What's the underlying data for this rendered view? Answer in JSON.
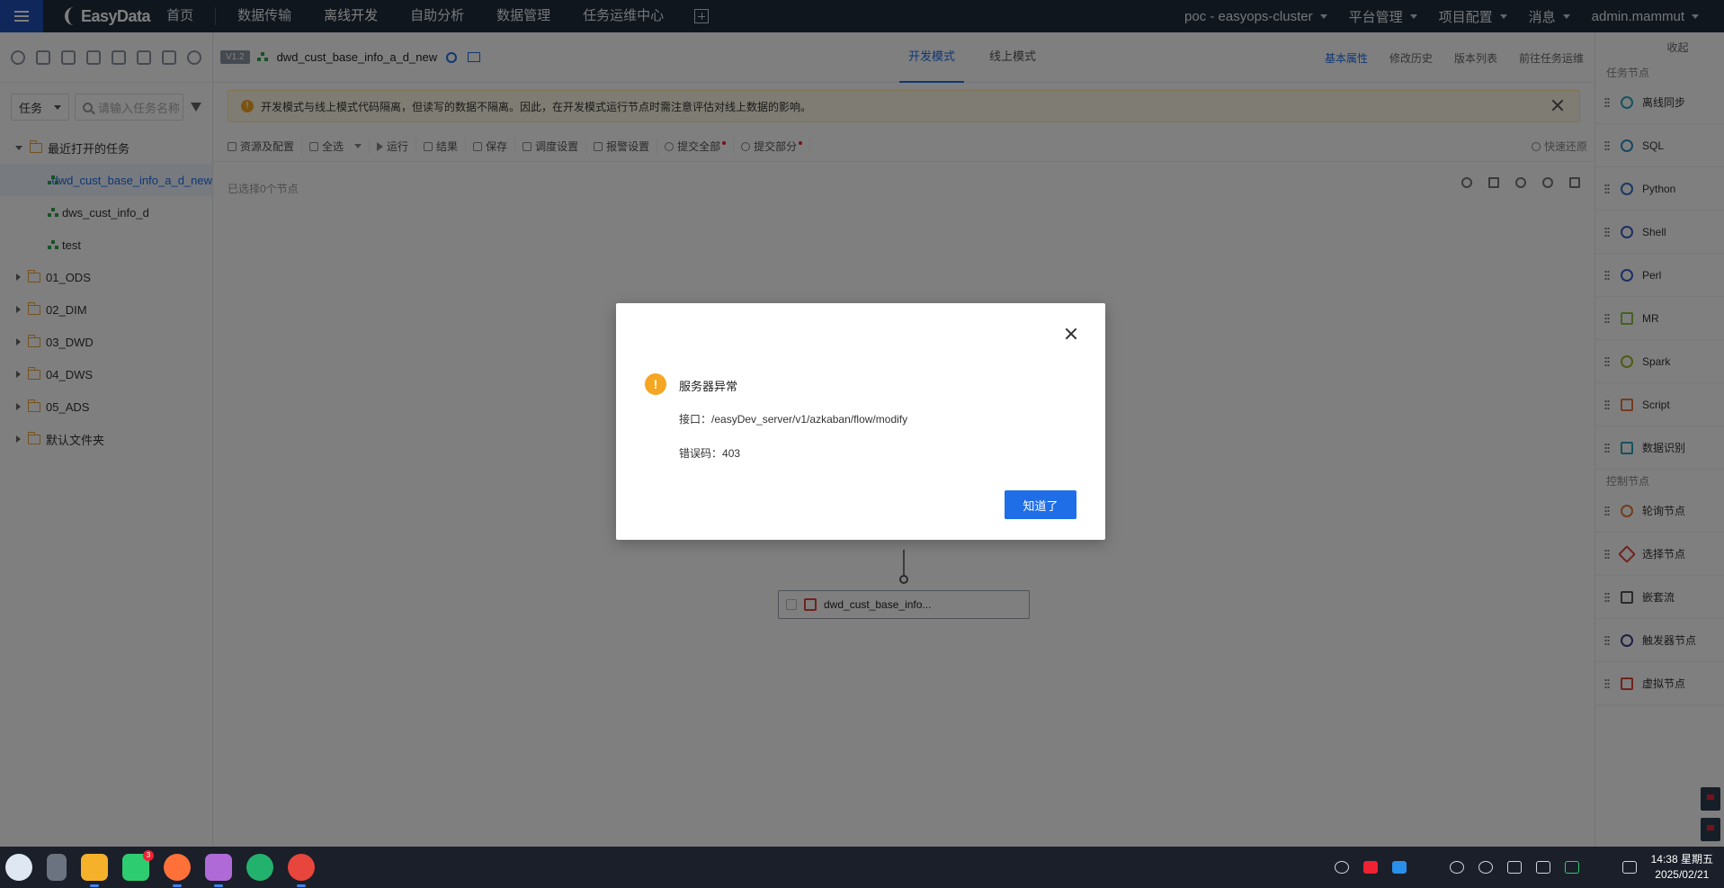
{
  "topnav": {
    "logo": "EasyData",
    "items": [
      "首页",
      "数据传输",
      "离线开发",
      "自助分析",
      "数据管理",
      "任务运维中心"
    ],
    "right": {
      "cluster": "poc - easyops-cluster",
      "platform": "平台管理",
      "project": "项目配置",
      "messages": "消息",
      "user": "admin.mammut"
    }
  },
  "left": {
    "type_select": "任务",
    "search_placeholder": "请输入任务名称",
    "recent_folder": "最近打开的任务",
    "recent_tasks": [
      "dwd_cust_base_info_a_d_new",
      "dws_cust_info_d",
      "test"
    ],
    "folders": [
      "01_ODS",
      "02_DIM",
      "03_DWD",
      "04_DWS",
      "05_ADS",
      "默认文件夹"
    ]
  },
  "header": {
    "version_badge": "V1.2",
    "task_name": "dwd_cust_base_info_a_d_new",
    "mode_tabs": [
      "开发模式",
      "线上模式"
    ],
    "right_links": [
      "基本属性",
      "修改历史",
      "版本列表",
      "前往任务运维"
    ]
  },
  "notice": {
    "text": "开发模式与线上模式代码隔离，但读写的数据不隔离。因此，在开发模式运行节点时需注意评估对线上数据的影响。"
  },
  "toolbar": {
    "resources": "资源及配置",
    "select_all": "全选",
    "run": "运行",
    "results": "结果",
    "save": "保存",
    "schedule": "调度设置",
    "alert": "报警设置",
    "submit_all": "提交全部",
    "submit_part": "提交部分",
    "quick_restore": "快速还原"
  },
  "canvas": {
    "selected_count": "已选择0个节点",
    "node_label": "dwd_cust_base_info..."
  },
  "right_panel": {
    "collapse": "收起",
    "task_section": "任务节点",
    "task_nodes": [
      "离线同步",
      "SQL",
      "Python",
      "Shell",
      "Perl",
      "MR",
      "Spark",
      "Script",
      "数据识别"
    ],
    "control_section": "控制节点",
    "control_nodes": [
      "轮询节点",
      "选择节点",
      "嵌套流",
      "触发器节点",
      "虚拟节点"
    ]
  },
  "dialog": {
    "title": "服务器异常",
    "endpoint_label": "接口：",
    "endpoint": "/easyDev_server/v1/azkaban/flow/modify",
    "code_label": "错误码：",
    "code": "403",
    "ok_button": "知道了"
  },
  "taskbar": {
    "badge_count": "3",
    "time": "14:38 星期五",
    "date": "2025/02/21"
  },
  "colors": {
    "accent": "#1f6ee8",
    "nav_bg": "#1f2d3d",
    "warning": "#f5a623",
    "overlay": "rgba(0,0,0,0.5)"
  }
}
